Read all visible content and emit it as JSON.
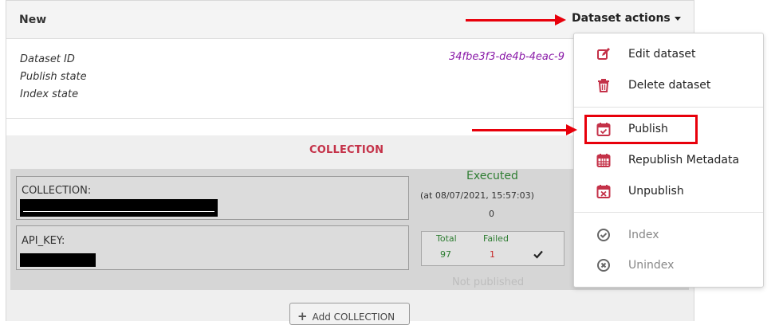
{
  "card": {
    "title": "New",
    "info_labels": [
      "Dataset ID",
      "Publish state",
      "Index state"
    ],
    "dataset_id": "34fbe3f3-de4b-4eac-9"
  },
  "actions": {
    "toggle_label": "Dataset actions",
    "menu": [
      {
        "label": "Edit dataset",
        "icon": "edit-icon",
        "enabled": true
      },
      {
        "label": "Delete dataset",
        "icon": "trash-icon",
        "enabled": true
      },
      {
        "label": "Publish",
        "icon": "calendar-check-icon",
        "enabled": true,
        "highlighted": true
      },
      {
        "label": "Republish Metadata",
        "icon": "calendar-grid-icon",
        "enabled": true
      },
      {
        "label": "Unpublish",
        "icon": "calendar-x-icon",
        "enabled": true
      },
      {
        "label": "Index",
        "icon": "circle-check-icon",
        "enabled": false
      },
      {
        "label": "Unindex",
        "icon": "circle-x-icon",
        "enabled": false
      }
    ]
  },
  "collection": {
    "section_title": "COLLECTION",
    "fields": [
      {
        "label": "COLLECTION:",
        "value_redacted": true
      },
      {
        "label": "API_KEY:",
        "value_redacted": true
      }
    ],
    "status": "Executed",
    "timestamp": "(at 08/07/2021, 15:57:03)",
    "count": "0",
    "stats": {
      "total_label": "Total",
      "failed_label": "Failed",
      "total": "97",
      "failed": "1"
    },
    "publish_status": "Not published",
    "add_button": "Add COLLECTION"
  },
  "colors": {
    "accent_red": "#c43148",
    "annotation_red": "#e8000b",
    "success_green": "#2e7d32",
    "id_purple": "#8a1aa8"
  }
}
